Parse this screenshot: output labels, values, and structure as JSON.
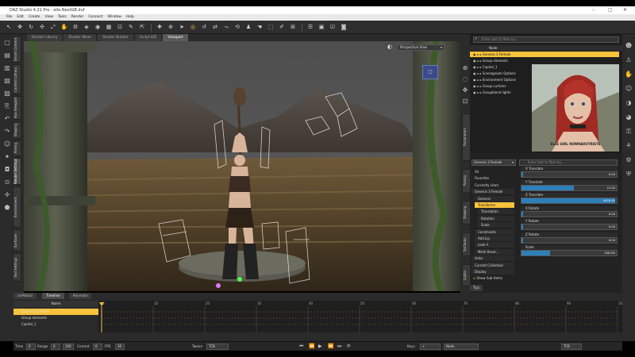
{
  "app": {
    "title": "DAZ Studio 4.21 Pro - elle.NextGB.duf",
    "window_controls": [
      "–",
      "▢",
      "✕"
    ]
  },
  "menu": [
    "File",
    "Edit",
    "Create",
    "View",
    "Tools",
    "Render",
    "Connect",
    "Window",
    "Help"
  ],
  "left_tabs": [
    "Smart Content",
    "Content Library",
    "Aux Viewport",
    "Shaping",
    "Posing",
    "Render Settings",
    "Environment",
    "Surfaces",
    "Tool Settings"
  ],
  "viewport_tabs": [
    "Render Library",
    "Shader Mixer",
    "Shader Builder",
    "Script IDE",
    "Viewport"
  ],
  "viewport": {
    "camera_select": "Perspective View",
    "badge": "▢"
  },
  "scene": {
    "search_placeholder": "Enter text to filter by...",
    "header": "Node",
    "rows": [
      {
        "label": "Genesis 3 Female",
        "selected": true
      },
      {
        "label": "Group elements",
        "selected": false
      },
      {
        "label": "Capitel_1",
        "selected": false
      },
      {
        "label": "Scenegroom Options",
        "selected": false
      },
      {
        "label": "Environment Options",
        "selected": false
      },
      {
        "label": "Group curtains",
        "selected": false
      },
      {
        "label": "Groupblend lights",
        "selected": false
      }
    ],
    "thumbnail_caption": "ELLE GIRL NORMADOTRISTE"
  },
  "params": {
    "node_select": "Genesis 3 Female",
    "search_placeholder": "Enter text to filter by...",
    "tree": [
      {
        "label": "All",
        "indent": 0,
        "sel": false
      },
      {
        "label": "Favorites",
        "indent": 0,
        "sel": false
      },
      {
        "label": "Currently Used",
        "indent": 0,
        "sel": false
      },
      {
        "label": "Genesis 3 Female",
        "indent": 0,
        "sel": false
      },
      {
        "label": "General",
        "indent": 1,
        "sel": false
      },
      {
        "label": "Transforms",
        "indent": 1,
        "sel": true
      },
      {
        "label": "Translation",
        "indent": 2,
        "sel": false
      },
      {
        "label": "Rotation",
        "indent": 2,
        "sel": false
      },
      {
        "label": "Scale",
        "indent": 2,
        "sel": false
      },
      {
        "label": "Constraints",
        "indent": 1,
        "sel": false
      },
      {
        "label": "Add.Lip",
        "indent": 1,
        "sel": false
      },
      {
        "label": "Look A",
        "indent": 1,
        "sel": false
      },
      {
        "label": "Mesh Resol...",
        "indent": 1,
        "sel": false
      },
      {
        "label": "Actor",
        "indent": 0,
        "sel": false
      },
      {
        "label": "Current Collection",
        "indent": 0,
        "sel": false
      },
      {
        "label": "Display",
        "indent": 0,
        "sel": false
      }
    ],
    "show_sub_items": "Show Sub Items",
    "sliders": [
      {
        "label": "X Translate",
        "value": "0.00",
        "fraction": 0.02
      },
      {
        "label": "Y Translate",
        "value": "11.02",
        "fraction": 0.55
      },
      {
        "label": "Z Translate",
        "value": "4410.40",
        "fraction": 0.98
      },
      {
        "label": "X Rotate",
        "value": "0.00",
        "fraction": 0.02
      },
      {
        "label": "Y Rotate",
        "value": "0.00",
        "fraction": 0.02
      },
      {
        "label": "Z Rotate",
        "value": "0.00",
        "fraction": 0.02
      },
      {
        "label": "Scale",
        "value": "100.0%",
        "fraction": 0.3
      }
    ],
    "right_tabs": [
      "Parameters",
      "Posing",
      "Shaping",
      "Surfaces",
      "Lights"
    ],
    "bottom_tab": "Tips"
  },
  "timeline": {
    "tabs": [
      "aniMate2",
      "Timeline",
      "Keymate"
    ],
    "active_tab": "Timeline",
    "header": "Name",
    "ticks": [
      "0",
      "10",
      "20",
      "30",
      "40",
      "50",
      "60",
      "70",
      "80",
      "90",
      "100"
    ],
    "rows": [
      {
        "label": "Genesis 3 Female",
        "selected": true
      },
      {
        "label": "Group elements",
        "selected": false
      },
      {
        "label": "Capitel_1",
        "selected": false
      }
    ]
  },
  "status": {
    "time_label": "Time",
    "time_value": "0",
    "range_label": "Range",
    "range_start": "0",
    "range_end": "100",
    "current_label": "Current",
    "current_value": "0",
    "fps_label": "FPS",
    "fps_value": "30",
    "tween_label": "Tween",
    "tween_value": "TCB",
    "keys_label": "Keys",
    "keys_value": "Node",
    "interp_value": "TCB"
  }
}
